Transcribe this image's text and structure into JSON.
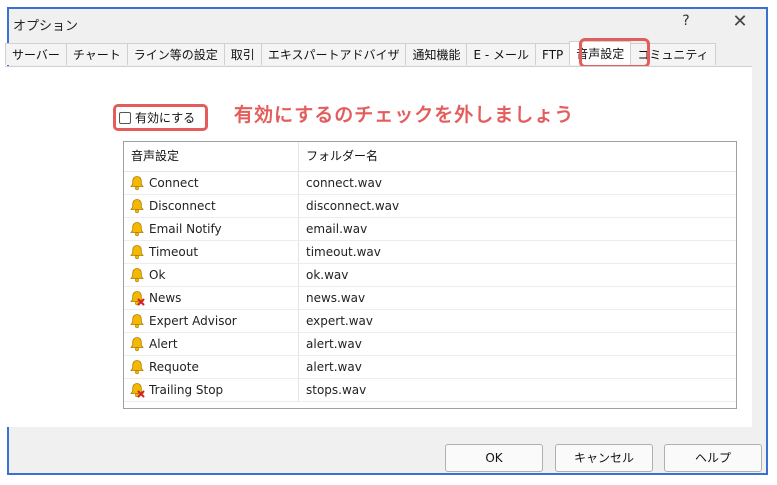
{
  "window": {
    "title": "オプション",
    "help_glyph": "?",
    "close_glyph": "✕"
  },
  "tabs": [
    {
      "label": "サーバー"
    },
    {
      "label": "チャート"
    },
    {
      "label": "ライン等の設定"
    },
    {
      "label": "取引"
    },
    {
      "label": "エキスパートアドバイザ"
    },
    {
      "label": "通知機能"
    },
    {
      "label": "E - メール"
    },
    {
      "label": "FTP"
    },
    {
      "label": "音声設定",
      "active": true
    },
    {
      "label": "コミュニティ"
    }
  ],
  "enable": {
    "label": "有効にする",
    "checked": false
  },
  "annotation": "有効にするのチェックを外しましょう",
  "table": {
    "headers": [
      "音声設定",
      "フォルダー名"
    ],
    "rows": [
      {
        "event": "Connect",
        "file": "connect.wav",
        "icon": "bell-icon"
      },
      {
        "event": "Disconnect",
        "file": "disconnect.wav",
        "icon": "bell-icon"
      },
      {
        "event": "Email Notify",
        "file": "email.wav",
        "icon": "bell-icon"
      },
      {
        "event": "Timeout",
        "file": "timeout.wav",
        "icon": "bell-icon"
      },
      {
        "event": "Ok",
        "file": "ok.wav",
        "icon": "bell-icon"
      },
      {
        "event": "News",
        "file": "news.wav",
        "icon": "bell-disabled-icon"
      },
      {
        "event": "Expert Advisor",
        "file": "expert.wav",
        "icon": "bell-icon"
      },
      {
        "event": "Alert",
        "file": "alert.wav",
        "icon": "bell-icon"
      },
      {
        "event": "Requote",
        "file": "alert.wav",
        "icon": "bell-icon"
      },
      {
        "event": "Trailing Stop",
        "file": "stops.wav",
        "icon": "bell-disabled-icon"
      }
    ]
  },
  "buttons": {
    "ok": "OK",
    "cancel": "キャンセル",
    "help": "ヘルプ"
  },
  "colors": {
    "highlight": "#e45d5d",
    "frame": "#3b6fd4",
    "bell": "#f5b800",
    "disabled_x": "#d42020"
  }
}
